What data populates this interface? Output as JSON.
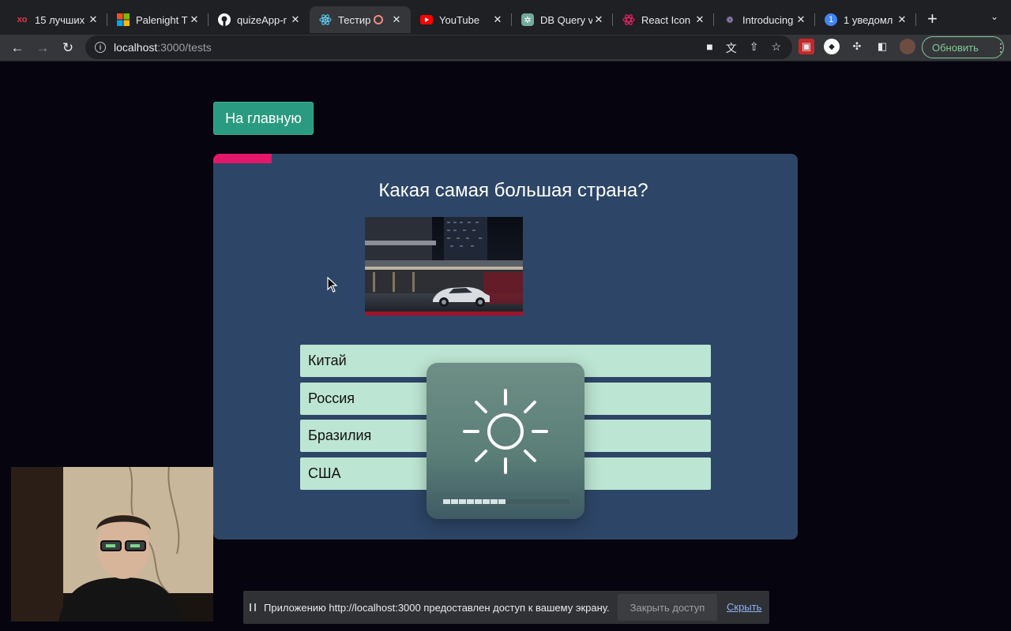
{
  "browser": {
    "tabs": [
      {
        "title": "15 лучших",
        "favicon": "xo-icon",
        "fav_color": "#e8344e",
        "active": false
      },
      {
        "title": "Palenight T",
        "favicon": "microsoft-icon",
        "fav_color": "#f25022",
        "active": false
      },
      {
        "title": "quizeApp-r",
        "favicon": "github-icon",
        "fav_color": "#ffffff",
        "active": false
      },
      {
        "title": "Тестир",
        "favicon": "react-icon",
        "fav_color": "#61dafb",
        "active": true
      },
      {
        "title": "YouTube",
        "favicon": "youtube-icon",
        "fav_color": "#ff0000",
        "active": false
      },
      {
        "title": "DB Query v",
        "favicon": "chatgpt-icon",
        "fav_color": "#74aa9c",
        "active": false
      },
      {
        "title": "React Icon",
        "favicon": "react-icons-icon",
        "fav_color": "#e91e63",
        "active": false
      },
      {
        "title": "Introducing",
        "favicon": "openai-icon",
        "fav_color": "#b39ddb",
        "active": false
      },
      {
        "title": "1 уведомл",
        "favicon": "notification-icon",
        "fav_color": "#4285f4",
        "active": false
      }
    ],
    "url_host": "localhost",
    "url_path": ":3000/tests",
    "update_label": "Обновить"
  },
  "page": {
    "home_button": "На главную",
    "progress_fraction": 0.1,
    "question": "Какая самая большая страна?",
    "answers": [
      "Китай",
      "Россия",
      "Бразилия",
      "США"
    ]
  },
  "overlay": {
    "icon": "brightness-icon",
    "level_fraction": 0.5
  },
  "share_bar": {
    "message": "Приложению http://localhost:3000 предоставлен доступ к вашему экрану.",
    "stop_label": "Закрыть доступ",
    "hide_label": "Скрыть"
  }
}
